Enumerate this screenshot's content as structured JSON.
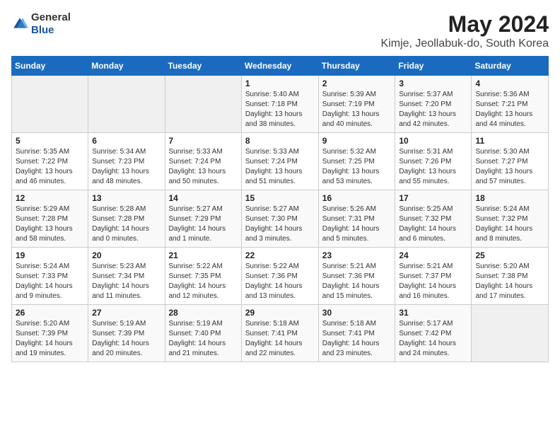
{
  "logo": {
    "general": "General",
    "blue": "Blue"
  },
  "title": "May 2024",
  "location": "Kimje, Jeollabuk-do, South Korea",
  "weekdays": [
    "Sunday",
    "Monday",
    "Tuesday",
    "Wednesday",
    "Thursday",
    "Friday",
    "Saturday"
  ],
  "weeks": [
    [
      {
        "day": "",
        "sunrise": "",
        "sunset": "",
        "daylight": ""
      },
      {
        "day": "",
        "sunrise": "",
        "sunset": "",
        "daylight": ""
      },
      {
        "day": "",
        "sunrise": "",
        "sunset": "",
        "daylight": ""
      },
      {
        "day": "1",
        "sunrise": "Sunrise: 5:40 AM",
        "sunset": "Sunset: 7:18 PM",
        "daylight": "Daylight: 13 hours and 38 minutes."
      },
      {
        "day": "2",
        "sunrise": "Sunrise: 5:39 AM",
        "sunset": "Sunset: 7:19 PM",
        "daylight": "Daylight: 13 hours and 40 minutes."
      },
      {
        "day": "3",
        "sunrise": "Sunrise: 5:37 AM",
        "sunset": "Sunset: 7:20 PM",
        "daylight": "Daylight: 13 hours and 42 minutes."
      },
      {
        "day": "4",
        "sunrise": "Sunrise: 5:36 AM",
        "sunset": "Sunset: 7:21 PM",
        "daylight": "Daylight: 13 hours and 44 minutes."
      }
    ],
    [
      {
        "day": "5",
        "sunrise": "Sunrise: 5:35 AM",
        "sunset": "Sunset: 7:22 PM",
        "daylight": "Daylight: 13 hours and 46 minutes."
      },
      {
        "day": "6",
        "sunrise": "Sunrise: 5:34 AM",
        "sunset": "Sunset: 7:23 PM",
        "daylight": "Daylight: 13 hours and 48 minutes."
      },
      {
        "day": "7",
        "sunrise": "Sunrise: 5:33 AM",
        "sunset": "Sunset: 7:24 PM",
        "daylight": "Daylight: 13 hours and 50 minutes."
      },
      {
        "day": "8",
        "sunrise": "Sunrise: 5:33 AM",
        "sunset": "Sunset: 7:24 PM",
        "daylight": "Daylight: 13 hours and 51 minutes."
      },
      {
        "day": "9",
        "sunrise": "Sunrise: 5:32 AM",
        "sunset": "Sunset: 7:25 PM",
        "daylight": "Daylight: 13 hours and 53 minutes."
      },
      {
        "day": "10",
        "sunrise": "Sunrise: 5:31 AM",
        "sunset": "Sunset: 7:26 PM",
        "daylight": "Daylight: 13 hours and 55 minutes."
      },
      {
        "day": "11",
        "sunrise": "Sunrise: 5:30 AM",
        "sunset": "Sunset: 7:27 PM",
        "daylight": "Daylight: 13 hours and 57 minutes."
      }
    ],
    [
      {
        "day": "12",
        "sunrise": "Sunrise: 5:29 AM",
        "sunset": "Sunset: 7:28 PM",
        "daylight": "Daylight: 13 hours and 58 minutes."
      },
      {
        "day": "13",
        "sunrise": "Sunrise: 5:28 AM",
        "sunset": "Sunset: 7:28 PM",
        "daylight": "Daylight: 14 hours and 0 minutes."
      },
      {
        "day": "14",
        "sunrise": "Sunrise: 5:27 AM",
        "sunset": "Sunset: 7:29 PM",
        "daylight": "Daylight: 14 hours and 1 minute."
      },
      {
        "day": "15",
        "sunrise": "Sunrise: 5:27 AM",
        "sunset": "Sunset: 7:30 PM",
        "daylight": "Daylight: 14 hours and 3 minutes."
      },
      {
        "day": "16",
        "sunrise": "Sunrise: 5:26 AM",
        "sunset": "Sunset: 7:31 PM",
        "daylight": "Daylight: 14 hours and 5 minutes."
      },
      {
        "day": "17",
        "sunrise": "Sunrise: 5:25 AM",
        "sunset": "Sunset: 7:32 PM",
        "daylight": "Daylight: 14 hours and 6 minutes."
      },
      {
        "day": "18",
        "sunrise": "Sunrise: 5:24 AM",
        "sunset": "Sunset: 7:32 PM",
        "daylight": "Daylight: 14 hours and 8 minutes."
      }
    ],
    [
      {
        "day": "19",
        "sunrise": "Sunrise: 5:24 AM",
        "sunset": "Sunset: 7:33 PM",
        "daylight": "Daylight: 14 hours and 9 minutes."
      },
      {
        "day": "20",
        "sunrise": "Sunrise: 5:23 AM",
        "sunset": "Sunset: 7:34 PM",
        "daylight": "Daylight: 14 hours and 11 minutes."
      },
      {
        "day": "21",
        "sunrise": "Sunrise: 5:22 AM",
        "sunset": "Sunset: 7:35 PM",
        "daylight": "Daylight: 14 hours and 12 minutes."
      },
      {
        "day": "22",
        "sunrise": "Sunrise: 5:22 AM",
        "sunset": "Sunset: 7:36 PM",
        "daylight": "Daylight: 14 hours and 13 minutes."
      },
      {
        "day": "23",
        "sunrise": "Sunrise: 5:21 AM",
        "sunset": "Sunset: 7:36 PM",
        "daylight": "Daylight: 14 hours and 15 minutes."
      },
      {
        "day": "24",
        "sunrise": "Sunrise: 5:21 AM",
        "sunset": "Sunset: 7:37 PM",
        "daylight": "Daylight: 14 hours and 16 minutes."
      },
      {
        "day": "25",
        "sunrise": "Sunrise: 5:20 AM",
        "sunset": "Sunset: 7:38 PM",
        "daylight": "Daylight: 14 hours and 17 minutes."
      }
    ],
    [
      {
        "day": "26",
        "sunrise": "Sunrise: 5:20 AM",
        "sunset": "Sunset: 7:39 PM",
        "daylight": "Daylight: 14 hours and 19 minutes."
      },
      {
        "day": "27",
        "sunrise": "Sunrise: 5:19 AM",
        "sunset": "Sunset: 7:39 PM",
        "daylight": "Daylight: 14 hours and 20 minutes."
      },
      {
        "day": "28",
        "sunrise": "Sunrise: 5:19 AM",
        "sunset": "Sunset: 7:40 PM",
        "daylight": "Daylight: 14 hours and 21 minutes."
      },
      {
        "day": "29",
        "sunrise": "Sunrise: 5:18 AM",
        "sunset": "Sunset: 7:41 PM",
        "daylight": "Daylight: 14 hours and 22 minutes."
      },
      {
        "day": "30",
        "sunrise": "Sunrise: 5:18 AM",
        "sunset": "Sunset: 7:41 PM",
        "daylight": "Daylight: 14 hours and 23 minutes."
      },
      {
        "day": "31",
        "sunrise": "Sunrise: 5:17 AM",
        "sunset": "Sunset: 7:42 PM",
        "daylight": "Daylight: 14 hours and 24 minutes."
      },
      {
        "day": "",
        "sunrise": "",
        "sunset": "",
        "daylight": ""
      }
    ]
  ]
}
